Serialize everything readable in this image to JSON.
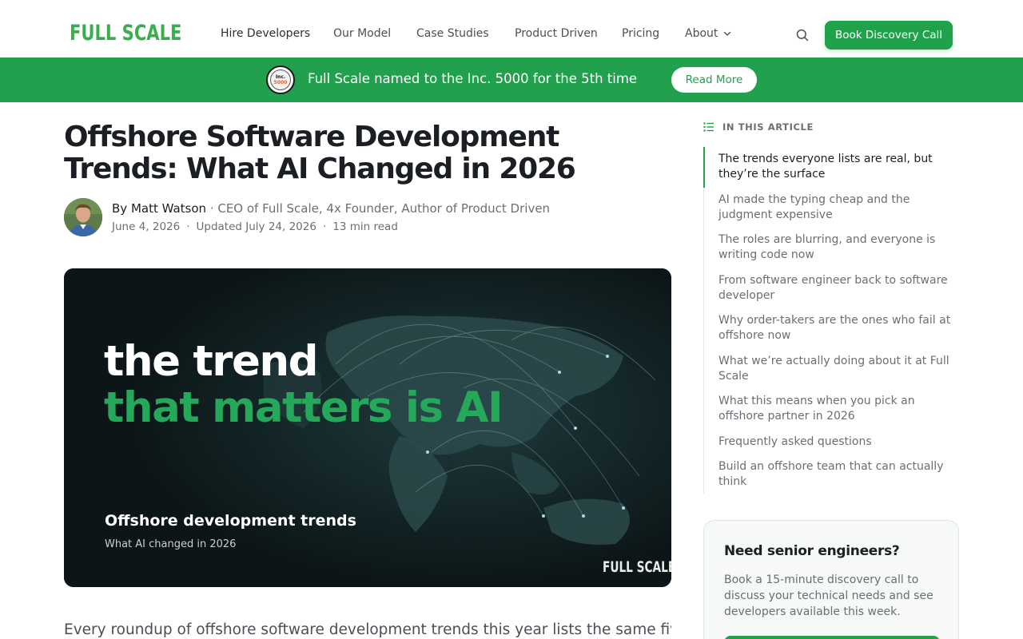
{
  "header": {
    "logo": "FULL SCALE",
    "nav": [
      "Hire Developers",
      "Our Model",
      "Case Studies",
      "Product Driven",
      "Pricing",
      "About"
    ],
    "cta": "Book Discovery Call"
  },
  "banner": {
    "badge_top": "Inc.",
    "badge_num": "5000",
    "text": "Full Scale named to the Inc. 5000 for the 5th time",
    "button": "Read More"
  },
  "article": {
    "title": "Offshore Software Development Trends: What AI Changed in 2026",
    "byline_prefix": "By ",
    "author": "Matt Watson",
    "author_role": " · CEO of Full Scale, 4x Founder, Author of Product Driven",
    "published": "June 4, 2026",
    "updated": "Updated July 24, 2026",
    "read_time": "13 min read",
    "hero": {
      "line1": "the trend",
      "line2": "that matters is AI",
      "subtitle": "Offshore development trends",
      "subtitle2": "What AI changed in 2026",
      "logo": "FULL SCALE"
    },
    "intro": "Every roundup of offshore software development trends this year lists the same five"
  },
  "toc": {
    "heading": "IN THIS ARTICLE",
    "items": [
      "The trends everyone lists are real, but they’re the surface",
      "AI made the typing cheap and the judgment expensive",
      "The roles are blurring, and everyone is writing code now",
      "From software engineer back to software developer",
      "Why order-takers are the ones who fail at offshore now",
      "What we’re actually doing about it at Full Scale",
      "What this means when you pick an offshore partner in 2026",
      "Frequently asked questions",
      "Build an offshore team that can actually think"
    ]
  },
  "card": {
    "title": "Need senior engineers?",
    "text": "Book a 15-minute discovery call to discuss your technical needs and see developers available this week."
  },
  "colors": {
    "brand_green": "#1fa24a",
    "banner_green": "#21a04e",
    "hero_green": "#25a85a"
  }
}
